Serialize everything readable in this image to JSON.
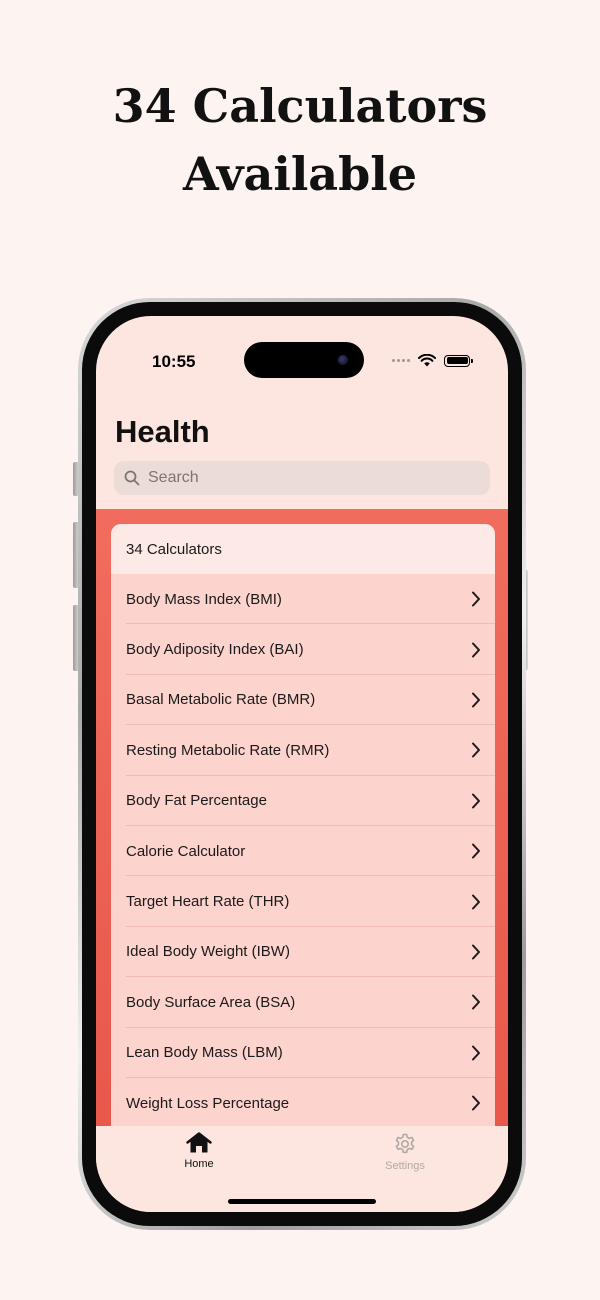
{
  "headline": {
    "line1": "34 Calculators",
    "line2": "Available"
  },
  "status": {
    "time": "10:55"
  },
  "nav": {
    "title": "Health"
  },
  "search": {
    "placeholder": "Search"
  },
  "list": {
    "header": "34 Calculators",
    "items": [
      "Body Mass Index (BMI)",
      "Body Adiposity Index (BAI)",
      "Basal Metabolic Rate (BMR)",
      "Resting Metabolic Rate (RMR)",
      "Body Fat Percentage",
      "Calorie Calculator",
      "Target Heart Rate (THR)",
      "Ideal Body Weight (IBW)",
      "Body Surface Area (BSA)",
      "Lean Body Mass (LBM)",
      "Weight Loss Percentage"
    ]
  },
  "tabs": [
    {
      "label": "Home",
      "icon": "house-icon",
      "active": true
    },
    {
      "label": "Settings",
      "icon": "gear-icon",
      "active": false
    }
  ],
  "colors": {
    "accent": "#ec5f52",
    "card": "#fdd3cd",
    "tab_active": "#111111",
    "tab_inactive": "#b0a8a6"
  }
}
